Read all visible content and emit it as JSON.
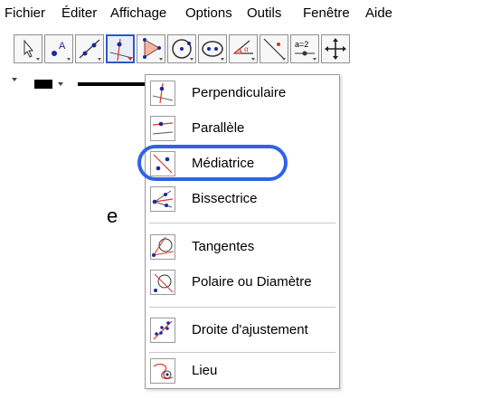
{
  "menubar": {
    "items": [
      "Fichier",
      "Éditer",
      "Affichage",
      "Options",
      "Outils",
      "Fenêtre",
      "Aide"
    ]
  },
  "toolbar": {
    "tools": [
      {
        "icon": "move-arrow-icon"
      },
      {
        "icon": "point-icon",
        "label": "A"
      },
      {
        "icon": "line-icon"
      },
      {
        "icon": "perpendicular-line-icon",
        "active": true
      },
      {
        "icon": "polygon-icon"
      },
      {
        "icon": "circle-icon"
      },
      {
        "icon": "ellipse-icon"
      },
      {
        "icon": "angle-icon",
        "label": "α"
      },
      {
        "icon": "reflect-icon"
      },
      {
        "icon": "slider-icon",
        "label": "a=2"
      },
      {
        "icon": "move-view-icon"
      }
    ]
  },
  "stylebar": {
    "color": "#000000"
  },
  "dropdown": {
    "items": [
      {
        "label": "Perpendiculaire",
        "icon": "perpendicular-icon"
      },
      {
        "label": "Parallèle",
        "icon": "parallel-icon"
      },
      {
        "label": "Médiatrice",
        "icon": "perpendicular-bisector-icon",
        "highlighted": true
      },
      {
        "label": "Bissectrice",
        "icon": "angle-bisector-icon"
      },
      {
        "label": "Tangentes",
        "icon": "tangents-icon"
      },
      {
        "label": "Polaire ou Diamètre",
        "icon": "polar-diameter-icon"
      },
      {
        "label": "Droite d'ajustement",
        "icon": "best-fit-line-icon"
      },
      {
        "label": "Lieu",
        "icon": "locus-icon"
      }
    ]
  },
  "background": {
    "partial_text": "e"
  },
  "colors": {
    "highlight": "#2f62e8",
    "active_tool": "#2b59c3",
    "accent_red": "#e0342b"
  }
}
